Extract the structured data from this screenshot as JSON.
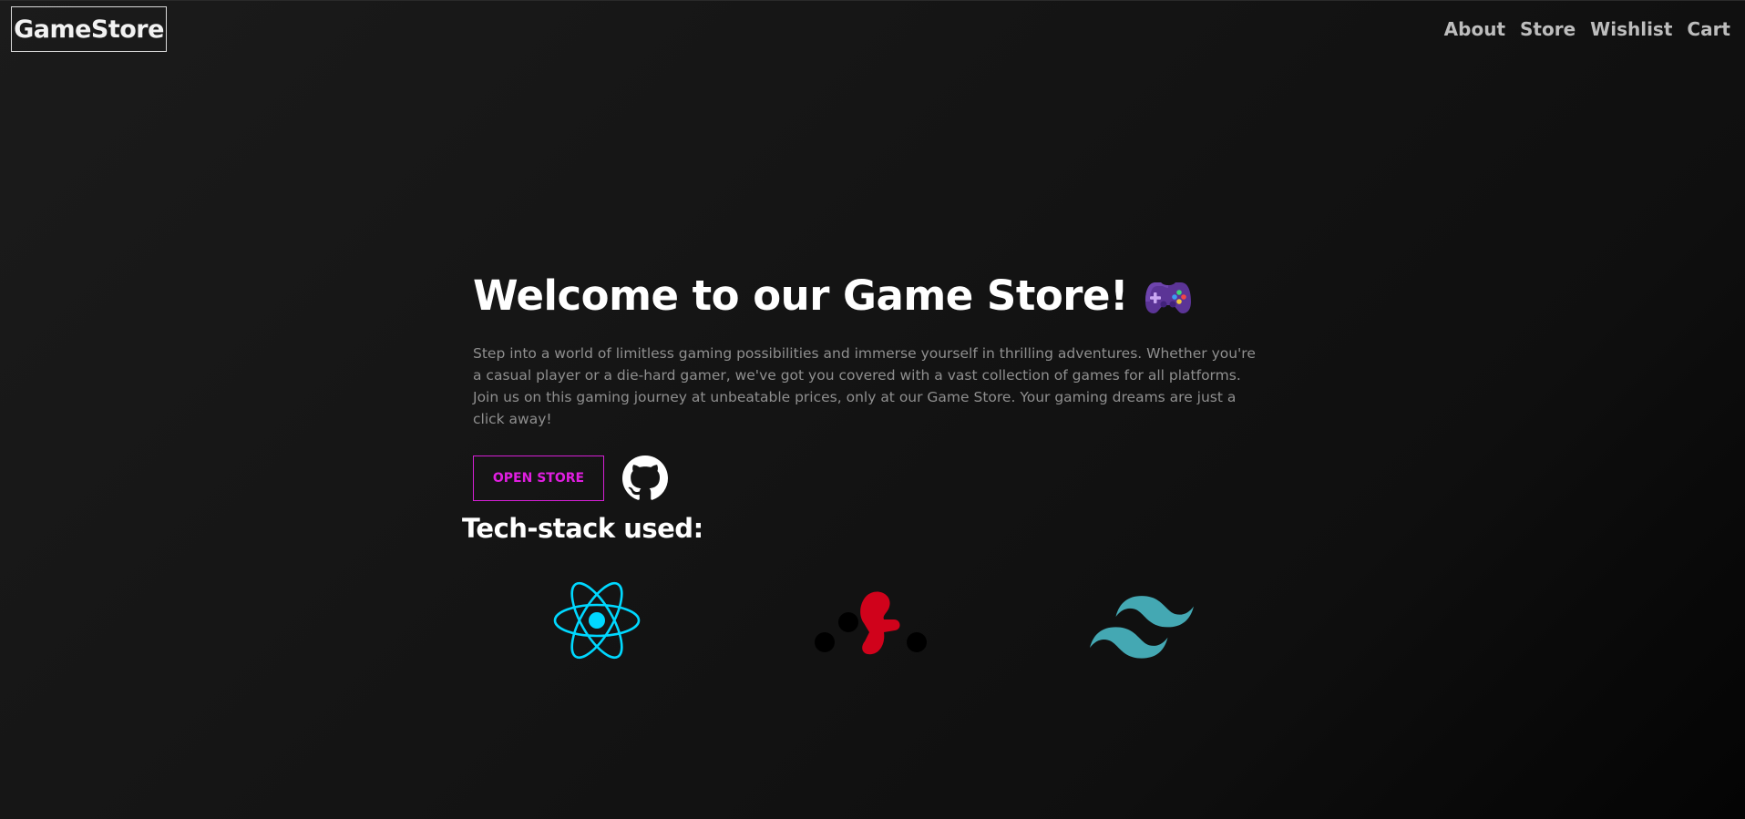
{
  "header": {
    "logo_text": "GameStore",
    "nav": [
      {
        "label": "About"
      },
      {
        "label": "Store"
      },
      {
        "label": "Wishlist"
      },
      {
        "label": "Cart"
      }
    ]
  },
  "hero": {
    "title": "Welcome to our Game Store!",
    "title_icon": "gamepad-icon",
    "description": "Step into a world of limitless gaming possibilities and immerse yourself in thrilling adventures. Whether you're a casual player or a die-hard gamer, we've got you covered with a vast collection of games for all platforms. Join us on this gaming journey at unbeatable prices, only at our Game Store. Your gaming dreams are just a click away!",
    "open_store_label": "OPEN STORE",
    "github_icon": "github-icon"
  },
  "tech_stack": {
    "title": "Tech-stack used:",
    "items": [
      {
        "icon": "react-icon",
        "color": "#00d8ff"
      },
      {
        "icon": "react-query-icon",
        "color": "#d0021b"
      },
      {
        "icon": "tailwind-icon",
        "color": "#44a8b3"
      }
    ]
  },
  "colors": {
    "accent": "#e01ee0",
    "text_muted": "#8f8f8f",
    "nav_text": "#bdbdbd"
  }
}
